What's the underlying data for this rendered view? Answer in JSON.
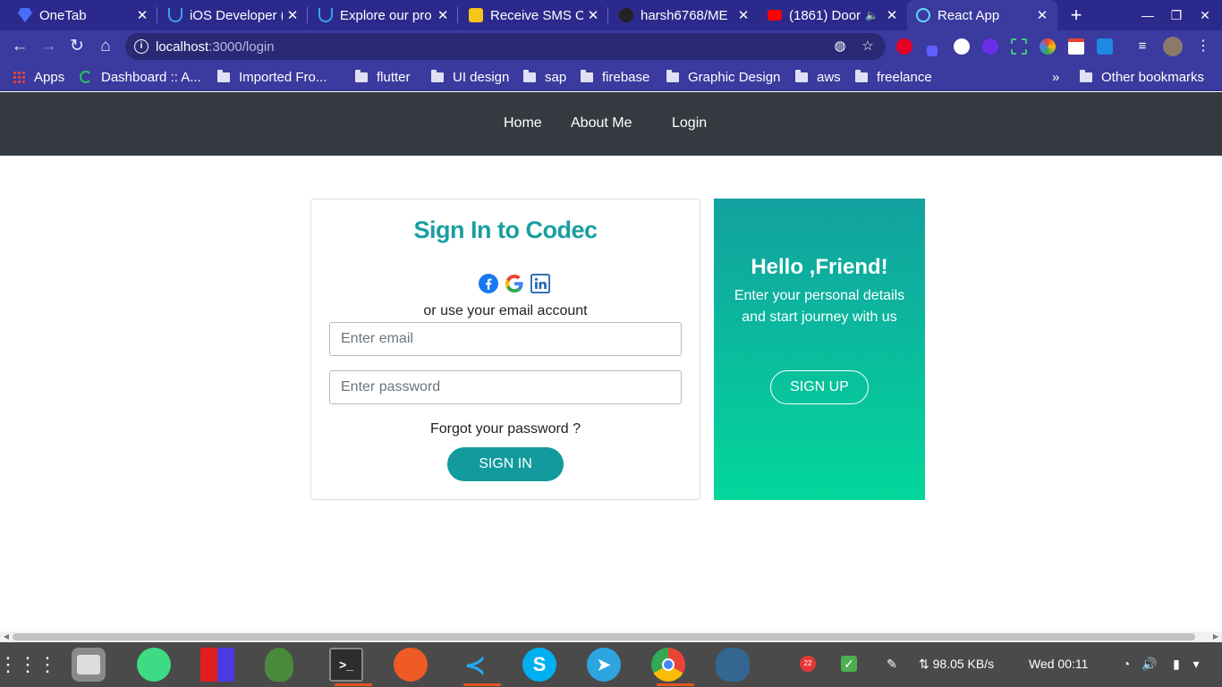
{
  "browser": {
    "tabs": [
      {
        "title": "OneTab",
        "favicon_color": "#4a6cf7",
        "active": false
      },
      {
        "title": "iOS Developer (",
        "favicon_color": "#3aa3e3",
        "active": false
      },
      {
        "title": "Explore our pro",
        "favicon_color": "#3aa3e3",
        "active": false
      },
      {
        "title": "Receive SMS Or",
        "favicon_color": "#f5c518",
        "active": false
      },
      {
        "title": "harsh6768/ME",
        "favicon_color": "#222222",
        "active": false
      },
      {
        "title": "(1861) Door",
        "favicon_color": "#ff0000",
        "active": false
      },
      {
        "title": "React App",
        "favicon_color": "#61dafb",
        "active": true
      }
    ],
    "tab_close_glyph": "✕",
    "new_tab_glyph": "+",
    "window_controls": {
      "minimize": "—",
      "maximize": "❐",
      "close": "✕"
    },
    "address": {
      "host": "localhost",
      "path": ":3000/login"
    },
    "nav": {
      "back": "←",
      "forward": "→",
      "reload": "↻",
      "home": "⌂"
    },
    "bookmarks": [
      {
        "label": "Apps",
        "type": "apps"
      },
      {
        "label": "Dashboard :: A...",
        "type": "site"
      },
      {
        "label": "Imported Fro...",
        "type": "folder"
      },
      {
        "label": "flutter",
        "type": "folder"
      },
      {
        "label": "UI design",
        "type": "folder"
      },
      {
        "label": "sap",
        "type": "folder"
      },
      {
        "label": "firebase",
        "type": "folder"
      },
      {
        "label": "Graphic Design",
        "type": "folder"
      },
      {
        "label": "aws",
        "type": "folder"
      },
      {
        "label": "freelance",
        "type": "folder"
      }
    ],
    "bookmarks_overflow": "»",
    "other_bookmarks": "Other bookmarks"
  },
  "app": {
    "nav_links": [
      "Home",
      "About Me",
      "Login"
    ],
    "signin": {
      "title": "Sign In to Codec",
      "social_icons": [
        "facebook-icon",
        "google-icon",
        "linkedin-icon"
      ],
      "or_text": "or use your email account",
      "email_placeholder": "Enter email",
      "password_placeholder": "Enter password",
      "forgot_text": "Forgot your password ?",
      "button_label": "SIGN IN",
      "accent_color": "#129a9c"
    },
    "promo": {
      "title": "Hello ,Friend!",
      "text": "Enter your personal details and start journey with us",
      "button_label": "SIGN UP",
      "gradient_top": "#12a19f",
      "gradient_bottom": "#03d69b"
    }
  },
  "taskbar": {
    "network_speed": "98.05 KB/s",
    "clock": "Wed 00:11",
    "badge_count": "22"
  }
}
